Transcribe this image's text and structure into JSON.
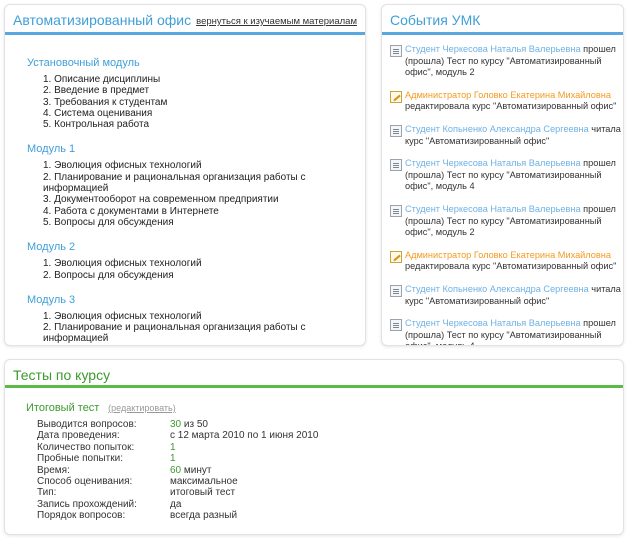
{
  "office": {
    "title": "Автоматизированный офис",
    "back_link": "вернуться к изучаемым материалам",
    "modules": [
      {
        "title": "Установочный модуль",
        "items": [
          "1. Описание дисциплины",
          "2. Введение в предмет",
          "3. Требования к студентам",
          "4. Система оценивания",
          "5. Контрольная работа"
        ]
      },
      {
        "title": "Модуль 1",
        "items": [
          "1. Эволюция офисных технологий",
          "2. Планирование и рациональная организация работы с информацией",
          "3. Документооборот на современном предприятии",
          "4. Работа с документами в Интернете",
          "5. Вопросы для обсуждения"
        ]
      },
      {
        "title": "Модуль 2",
        "items": [
          "1. Эволюция офисных технологий",
          "2. Вопросы для обсуждения"
        ]
      },
      {
        "title": "Модуль 3",
        "items": [
          "1. Эволюция офисных технологий",
          "2. Планирование и рациональная организация работы с информацией",
          "3. Документооборот на современном предприятии"
        ]
      }
    ]
  },
  "events": {
    "title": "События УМК",
    "items": [
      {
        "icon": "document-icon",
        "actor": "Студент Черкесова Наталья Валерьевна",
        "actor_type": "user",
        "text": " прошел (прошла) Тест по курсу \"Автоматизированный офис\", модуль 2"
      },
      {
        "icon": "edit-icon",
        "actor": "Администратор Головко Екатерина Михайловна",
        "actor_type": "admin",
        "text": " редактировала курс \"Автоматизированный офис\""
      },
      {
        "icon": "document-icon",
        "actor": "Студент Копьненко Александра Сергеевна",
        "actor_type": "user",
        "text": " читала курс \"Автоматизированный офис\""
      },
      {
        "icon": "document-icon",
        "actor": "Студент Черкесова Наталья Валерьевна",
        "actor_type": "user",
        "text": " прошел (прошла) Тест по курсу \"Автоматизированный офис\", модуль 4"
      },
      {
        "icon": "document-icon",
        "actor": "Студент Черкесова Наталья Валерьевна",
        "actor_type": "user",
        "text": " прошел (прошла) Тест по курсу \"Автоматизированный офис\", модуль 2"
      },
      {
        "icon": "edit-icon",
        "actor": "Администратор Головко Екатерина Михайловна",
        "actor_type": "admin",
        "text": " редактировала курс \"Автоматизированный офис\""
      },
      {
        "icon": "document-icon",
        "actor": "Студент Копьненко Александра Сергеевна",
        "actor_type": "user",
        "text": " читала курс \"Автоматизированный офис\""
      },
      {
        "icon": "document-icon",
        "actor": "Студент Черкесова Наталья Валерьевна",
        "actor_type": "user",
        "text": " прошел (прошла) Тест по курсу \"Автоматизированный офис\", модуль 4"
      },
      {
        "icon": "document-icon",
        "actor": "Студент Черкесова Наталья Валерьевна",
        "actor_type": "user",
        "text": " прошел (прошла) Тест по курсу \"Автоматизированный офис\", модуль 2"
      }
    ]
  },
  "tests": {
    "title": "Тесты по курсу",
    "test_name": "Итоговый тест",
    "edit_label": "(редактировать)",
    "properties": [
      {
        "label": "Выводится вопросов:",
        "value": "30",
        "value_rest": " из 50"
      },
      {
        "label": "Дата проведения:",
        "value": "",
        "value_rest": "с 12 марта 2010 по 1 июня 2010"
      },
      {
        "label": "Количество попыток:",
        "value": "1",
        "value_rest": ""
      },
      {
        "label": "Пробные попытки:",
        "value": "1",
        "value_rest": ""
      },
      {
        "label": "Время:",
        "value": "60",
        "value_rest": " минут"
      },
      {
        "label": "Способ оценивания:",
        "value": "",
        "value_rest": "максимальное"
      },
      {
        "label": "Тип:",
        "value": "",
        "value_rest": "итоговый тест"
      },
      {
        "label": "Запись прохождений:",
        "value": "",
        "value_rest": "да"
      },
      {
        "label": "Порядок вопросов:",
        "value": "",
        "value_rest": "всегда разный"
      }
    ]
  },
  "colors": {
    "blue_accent": "#3f9fd8",
    "green_accent": "#3c9a2e",
    "admin_orange": "#f39a1e",
    "user_blue": "#6fb1e4"
  }
}
